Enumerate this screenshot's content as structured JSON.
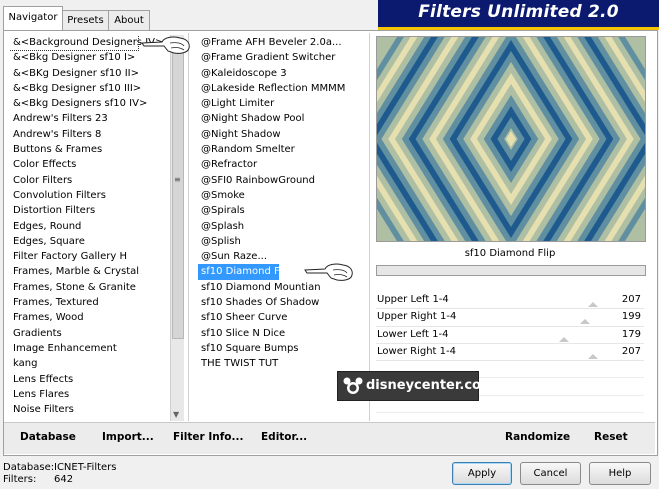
{
  "app_title": "Filters Unlimited 2.0",
  "tabs": [
    {
      "label": "Navigator",
      "active": true
    },
    {
      "label": "Presets",
      "active": false
    },
    {
      "label": "About",
      "active": false
    }
  ],
  "categories": [
    {
      "label": "&<Background Designers IV>",
      "selected": true
    },
    {
      "label": "&<Bkg Designer sf10 I>"
    },
    {
      "label": "&<BKg Designer sf10 II>"
    },
    {
      "label": "&<Bkg Designer sf10 III>"
    },
    {
      "label": "&<Bkg Designers sf10 IV>"
    },
    {
      "label": "Andrew's Filters 23"
    },
    {
      "label": "Andrew's Filters 8"
    },
    {
      "label": "Buttons & Frames"
    },
    {
      "label": "Color Effects"
    },
    {
      "label": "Color Filters"
    },
    {
      "label": "Convolution Filters"
    },
    {
      "label": "Distortion Filters"
    },
    {
      "label": "Edges, Round"
    },
    {
      "label": "Edges, Square"
    },
    {
      "label": "Filter Factory Gallery H"
    },
    {
      "label": "Frames, Marble & Crystal"
    },
    {
      "label": "Frames, Stone & Granite"
    },
    {
      "label": "Frames, Textured"
    },
    {
      "label": "Frames, Wood"
    },
    {
      "label": "Gradients"
    },
    {
      "label": "Image Enhancement"
    },
    {
      "label": "kang"
    },
    {
      "label": "Lens Effects"
    },
    {
      "label": "Lens Flares"
    },
    {
      "label": "Noise Filters"
    }
  ],
  "filters": [
    {
      "label": "@Frame AFH Beveler 2.0a..."
    },
    {
      "label": "@Frame Gradient Switcher"
    },
    {
      "label": "@Kaleidoscope 3"
    },
    {
      "label": "@Lakeside Reflection MMMM"
    },
    {
      "label": "@Light Limiter"
    },
    {
      "label": "@Night Shadow Pool"
    },
    {
      "label": "@Night Shadow"
    },
    {
      "label": "@Random Smelter"
    },
    {
      "label": "@Refractor"
    },
    {
      "label": "@SFI0 RainbowGround"
    },
    {
      "label": "@Smoke"
    },
    {
      "label": "@Spirals"
    },
    {
      "label": "@Splash"
    },
    {
      "label": "@Splish"
    },
    {
      "label": "@Sun Raze..."
    },
    {
      "label": "sf10 Diamond Flip",
      "selected": true
    },
    {
      "label": "sf10 Diamond Mountian"
    },
    {
      "label": "sf10 Shades Of Shadow"
    },
    {
      "label": "sf10 Sheer Curve"
    },
    {
      "label": "sf10 Slice N Dice"
    },
    {
      "label": "sf10 Square Bumps"
    },
    {
      "label": "THE TWIST TUT"
    }
  ],
  "preview": {
    "filter_name": "sf10 Diamond Flip",
    "colors": [
      "#1e5a8e",
      "#5f8fa0",
      "#aebfa3",
      "#e6dfb0"
    ]
  },
  "params": [
    {
      "label": "Upper Left 1-4",
      "value": "207",
      "fraction": 0.81
    },
    {
      "label": "Upper Right 1-4",
      "value": "199",
      "fraction": 0.78
    },
    {
      "label": "Lower Left 1-4",
      "value": "179",
      "fraction": 0.7
    },
    {
      "label": "Lower Right 1-4",
      "value": "207",
      "fraction": 0.81
    }
  ],
  "bottom_buttons": {
    "database": "Database",
    "import": "Import...",
    "filter_info": "Filter Info...",
    "editor": "Editor...",
    "randomize": "Randomize",
    "reset": "Reset"
  },
  "status": {
    "database_label": "Database:",
    "database_value": "ICNET-Filters",
    "filters_label": "Filters:",
    "filters_value": "642"
  },
  "dialog_buttons": {
    "apply": "Apply",
    "cancel": "Cancel",
    "help": "Help"
  },
  "watermark": {
    "text": "disneycenter.com",
    "icon": "mickey-icon"
  }
}
